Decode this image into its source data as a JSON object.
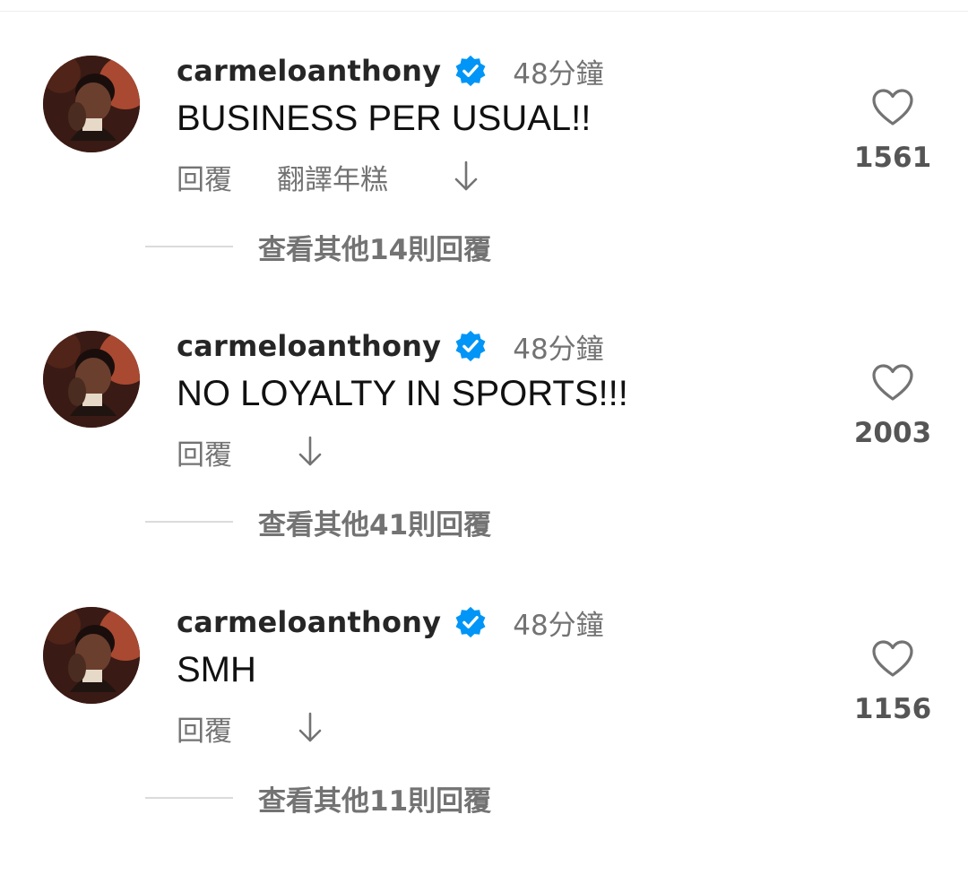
{
  "comments": [
    {
      "username": "carmeloanthony",
      "verified": true,
      "timestamp": "48分鐘",
      "text": "BUSINESS PER USUAL!!",
      "reply_label": "回覆",
      "translate_label": "翻譯年糕",
      "likes": "1561",
      "view_replies": "查看其他14則回覆"
    },
    {
      "username": "carmeloanthony",
      "verified": true,
      "timestamp": "48分鐘",
      "text": "NO LOYALTY IN SPORTS!!!",
      "reply_label": "回覆",
      "likes": "2003",
      "view_replies": "查看其他41則回覆"
    },
    {
      "username": "carmeloanthony",
      "verified": true,
      "timestamp": "48分鐘",
      "text": "SMH",
      "reply_label": "回覆",
      "likes": "1156",
      "view_replies": "查看其他11則回覆"
    }
  ],
  "icons": {
    "verified": "verified-badge-icon",
    "like": "heart-outline-icon",
    "more": "arrow-down-icon"
  },
  "colors": {
    "verified_blue": "#0095f6",
    "secondary_text": "#737373",
    "primary_text": "#111111"
  }
}
